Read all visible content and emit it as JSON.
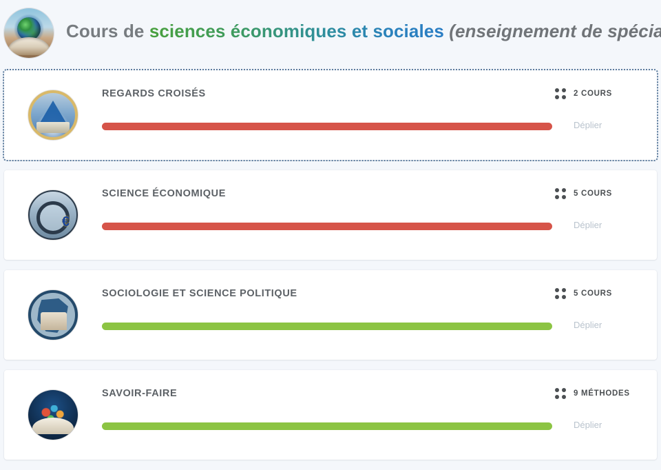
{
  "header": {
    "avatar_icon": "globe-book-gear-icon",
    "text_prefix": "Cours de ",
    "text_highlight": "sciences économiques et sociales",
    "text_suffix": " (enseignement de spécialité)",
    "highlight_gradient_from": "#49a03e",
    "highlight_gradient_to": "#2a7dc4",
    "prefix_color": "#777c80"
  },
  "colors": {
    "page_background": "#f4f7fb",
    "card_background": "#ffffff",
    "progress_red": "#d65449",
    "progress_green": "#8cc443",
    "title_text": "#5c6166",
    "meta_text": "#4b4f52",
    "link_text": "#b9c3cd",
    "focus_outline": "#5a7a9c"
  },
  "cards": [
    {
      "thumb_icon": "pyramid-diploma-icon",
      "thumb_class": "t-regards",
      "title": "REGARDS CROISÉS",
      "count_label": "2 COURS",
      "count_icon": "four-dots-icon",
      "expand_label": "Déplier",
      "progress_percent": 100,
      "progress_color": "#d65449",
      "focused": true
    },
    {
      "thumb_icon": "magnifier-euro-city-icon",
      "thumb_class": "t-eco",
      "title": "SCIENCE ÉCONOMIQUE",
      "count_label": "5 COURS",
      "count_icon": "four-dots-icon",
      "expand_label": "Déplier",
      "progress_percent": 100,
      "progress_color": "#d65449",
      "focused": false
    },
    {
      "thumb_icon": "france-map-monument-icon",
      "thumb_class": "t-socio",
      "title": "SOCIOLOGIE ET SCIENCE POLITIQUE",
      "count_label": "5 COURS",
      "count_icon": "four-dots-icon",
      "expand_label": "Déplier",
      "progress_percent": 100,
      "progress_color": "#8cc443",
      "focused": false
    },
    {
      "thumb_icon": "open-book-burst-icon",
      "thumb_class": "t-savoir",
      "title": "SAVOIR-FAIRE",
      "count_label": "9 MÉTHODES",
      "count_icon": "four-dots-icon",
      "expand_label": "Déplier",
      "progress_percent": 100,
      "progress_color": "#8cc443",
      "focused": false
    }
  ]
}
